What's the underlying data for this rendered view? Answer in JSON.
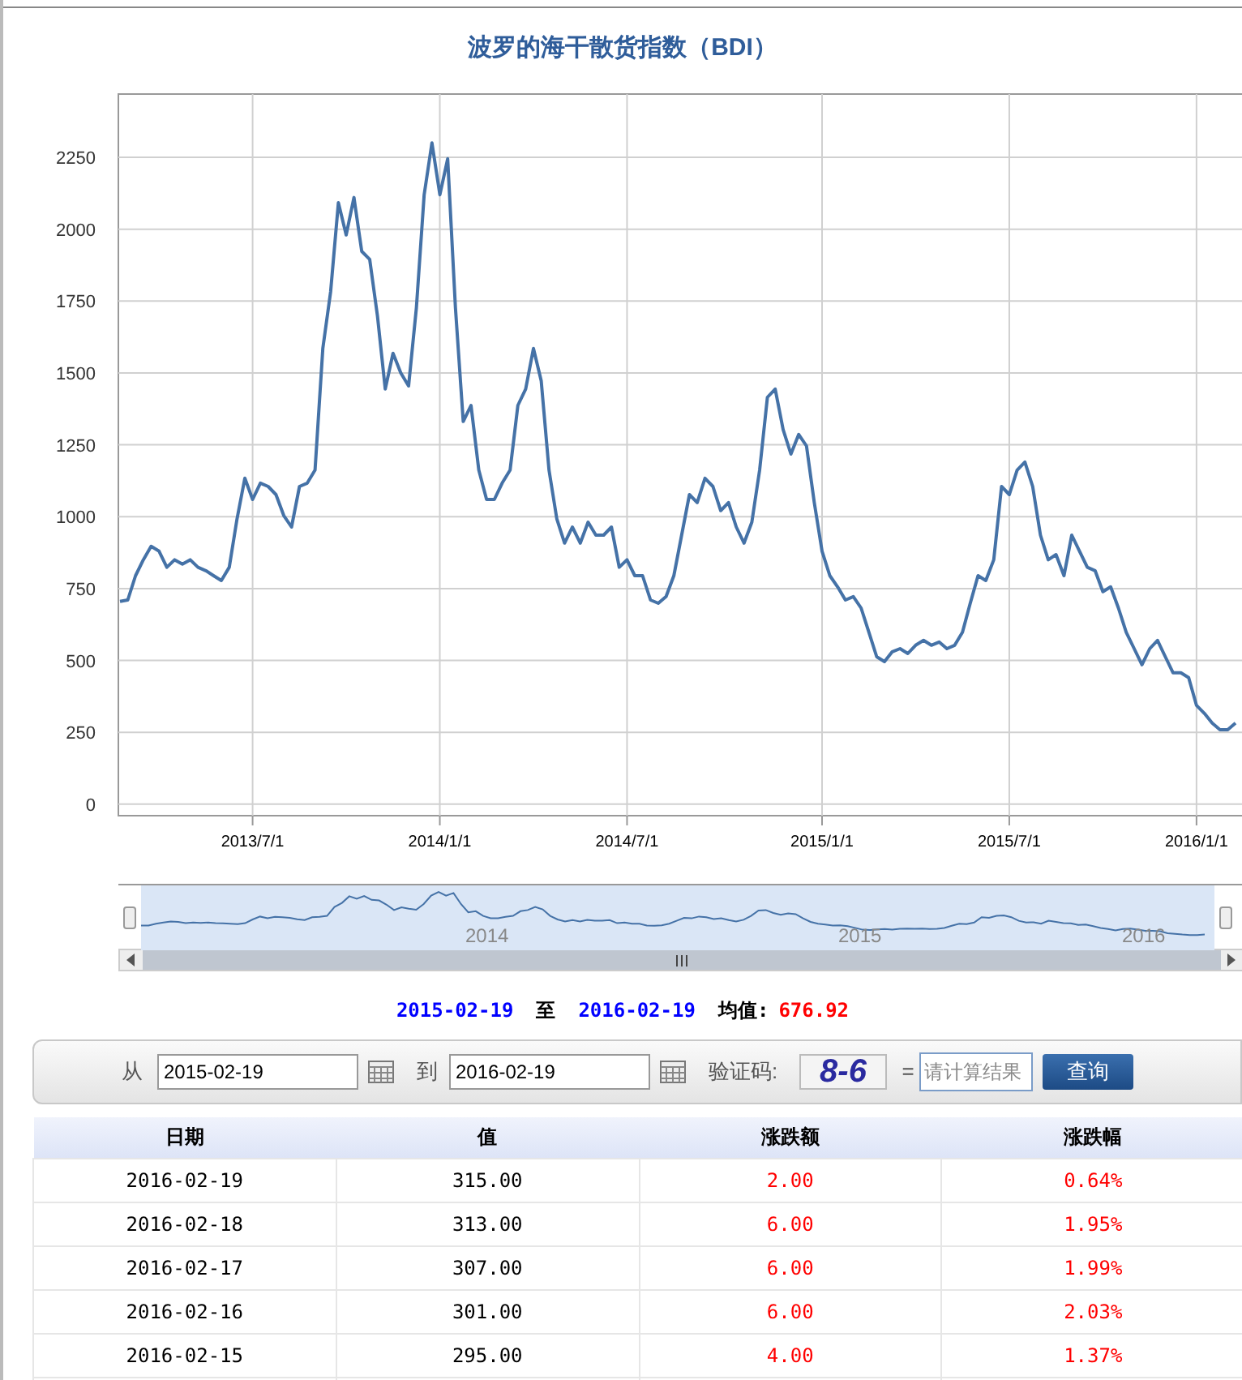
{
  "title": "波罗的海干散货指数（BDI）",
  "chart": {
    "chart_data": {
      "type": "line",
      "grid": true,
      "ylim": [
        -40,
        2470
      ],
      "yticks": [
        0,
        250,
        500,
        750,
        1000,
        1250,
        1500,
        1750,
        2000,
        2250
      ],
      "categories": [
        null,
        null,
        null,
        null,
        null,
        null,
        null,
        null,
        null,
        null,
        null,
        null,
        null,
        null,
        null,
        null,
        null,
        "2013/7/1",
        null,
        null,
        null,
        null,
        null,
        null,
        null,
        null,
        null,
        null,
        null,
        null,
        null,
        null,
        null,
        null,
        null,
        null,
        null,
        null,
        null,
        null,
        null,
        "2014/1/1",
        null,
        null,
        null,
        null,
        null,
        null,
        null,
        null,
        null,
        null,
        null,
        null,
        null,
        null,
        null,
        null,
        null,
        null,
        null,
        null,
        null,
        null,
        null,
        "2014/7/1",
        null,
        null,
        null,
        null,
        null,
        null,
        null,
        null,
        null,
        null,
        null,
        null,
        null,
        null,
        null,
        null,
        null,
        null,
        null,
        null,
        null,
        null,
        null,
        null,
        "2015/1/1",
        null,
        null,
        null,
        null,
        null,
        null,
        null,
        null,
        null,
        null,
        null,
        null,
        null,
        null,
        null,
        null,
        null,
        null,
        null,
        null,
        null,
        null,
        null,
        "2015/7/1",
        null,
        null,
        null,
        null,
        null,
        null,
        null,
        null,
        null,
        null,
        null,
        null,
        null,
        null,
        null,
        null,
        null,
        null,
        null,
        null,
        null,
        null,
        null,
        "2016/1/1",
        null,
        null,
        null,
        null,
        null
      ],
      "series": [
        {
          "color": "#4572a7",
          "values": [
            705,
            710,
            795,
            850,
            897,
            880,
            824,
            850,
            835,
            850,
            824,
            812,
            795,
            778,
            824,
            993,
            1134,
            1060,
            1117,
            1105,
            1077,
            1004,
            964,
            1105,
            1117,
            1162,
            1585,
            1782,
            2092,
            1980,
            2110,
            1923,
            1895,
            1698,
            1444,
            1568,
            1500,
            1455,
            1726,
            2120,
            2300,
            2120,
            2245,
            1726,
            1331,
            1387,
            1162,
            1060,
            1060,
            1117,
            1162,
            1387,
            1444,
            1585,
            1472,
            1162,
            993,
            908,
            964,
            908,
            981,
            936,
            936,
            964,
            824,
            850,
            795,
            795,
            710,
            699,
            722,
            795,
            936,
            1077,
            1049,
            1134,
            1105,
            1021,
            1049,
            964,
            908,
            981,
            1162,
            1415,
            1444,
            1303,
            1218,
            1286,
            1246,
            1049,
            880,
            795,
            756,
            710,
            722,
            682,
            598,
            513,
            496,
            530,
            541,
            524,
            553,
            570,
            553,
            564,
            541,
            553,
            598,
            699,
            795,
            778,
            850,
            1105,
            1077,
            1162,
            1190,
            1105,
            936,
            850,
            868,
            795,
            936,
            880,
            824,
            812,
            739,
            756,
            682,
            598,
            541,
            485,
            541,
            570,
            513,
            457,
            457,
            440,
            344,
            316,
            282,
            259,
            259,
            282
          ]
        }
      ]
    }
  },
  "navigator": {
    "labels": [
      "2014",
      "2015",
      "2016"
    ]
  },
  "summary": {
    "from": "2015-02-19",
    "separator": "至",
    "to": "2016-02-19",
    "average_label": "均值:",
    "average": "676.92"
  },
  "form": {
    "from_label": "从",
    "from_value": "2015-02-19",
    "to_label": "到",
    "to_value": "2016-02-19",
    "captcha_label": "验证码:",
    "captcha": "8-6",
    "equals": "=",
    "answer_placeholder": "请计算结果",
    "button": "查询"
  },
  "table": {
    "columns": [
      "日期",
      "值",
      "涨跌额",
      "涨跌幅"
    ],
    "rows": [
      {
        "color": "#ff0000",
        "cells": [
          "2016-02-19",
          "315.00",
          "2.00",
          "0.64%"
        ]
      },
      {
        "color": "#ff0000",
        "cells": [
          "2016-02-18",
          "313.00",
          "6.00",
          "1.95%"
        ]
      },
      {
        "color": "#ff0000",
        "cells": [
          "2016-02-17",
          "307.00",
          "6.00",
          "1.99%"
        ]
      },
      {
        "color": "#ff0000",
        "cells": [
          "2016-02-16",
          "301.00",
          "6.00",
          "2.03%"
        ]
      },
      {
        "color": "#ff0000",
        "cells": [
          "2016-02-15",
          "295.00",
          "4.00",
          "1.37%"
        ]
      }
    ]
  }
}
